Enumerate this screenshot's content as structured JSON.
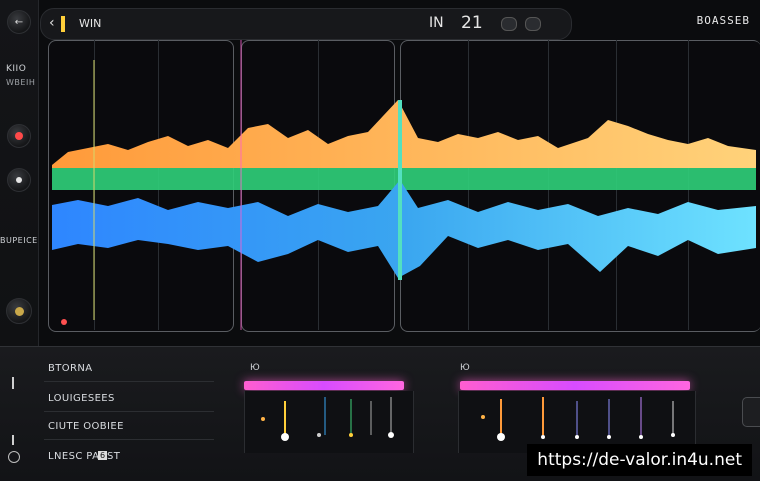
{
  "topbar": {
    "back_icon": "chevron-left-icon",
    "title": "WIN",
    "center_a": "IN",
    "center_b": "21",
    "right_label": "BOASSEB"
  },
  "rail": {
    "label_top_1": "KIIO",
    "label_top_2": "WBEIH",
    "label_mid": "BUPEICE"
  },
  "mixer": {
    "header": "BTORNA",
    "rows": [
      "LOUIGESEES",
      "CIUTE OOBIEE",
      "LNESC PAUST"
    ],
    "badge": "6",
    "track_a_label": "Ю",
    "track_b_label": "Ю"
  },
  "watermark": "https://de-valor.in4u.net",
  "colors": {
    "orange": "#f4a63a",
    "green": "#3fd27a",
    "blue": "#3aa6f0",
    "pink": "#ff5ed0",
    "accent_yellow": "#ffcf3a"
  }
}
